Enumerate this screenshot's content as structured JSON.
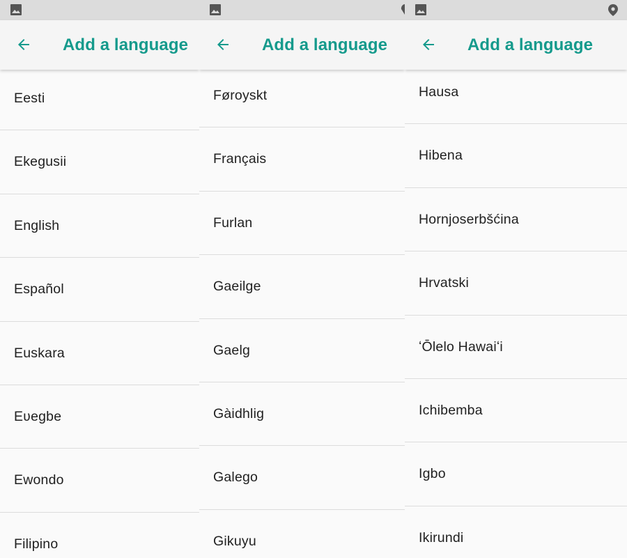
{
  "header": {
    "title": "Add a language",
    "back_icon": "arrow-back-icon"
  },
  "colors": {
    "accent": "#159a8c",
    "status_bar": "#dcdcdc",
    "background": "#fafafa",
    "text": "#212121",
    "divider": "#dcdcdc"
  },
  "status_icons": [
    "image-icon",
    "location-pin-icon"
  ],
  "panels": [
    {
      "items": [
        "Eesti",
        "Ekegusii",
        "English",
        "Español",
        "Euskara",
        "Eʋegbe",
        "Ewondo",
        "Filipino"
      ]
    },
    {
      "items": [
        "Føroyskt",
        "Français",
        "Furlan",
        "Gaeilge",
        "Gaelg",
        "Gàidhlig",
        "Galego",
        "Gikuyu"
      ]
    },
    {
      "items": [
        "Hausa",
        "Hibena",
        "Hornjoserbšćina",
        "Hrvatski",
        "ʻŌlelo Hawaiʻi",
        "Ichibemba",
        "Igbo",
        "Ikirundi"
      ]
    }
  ]
}
